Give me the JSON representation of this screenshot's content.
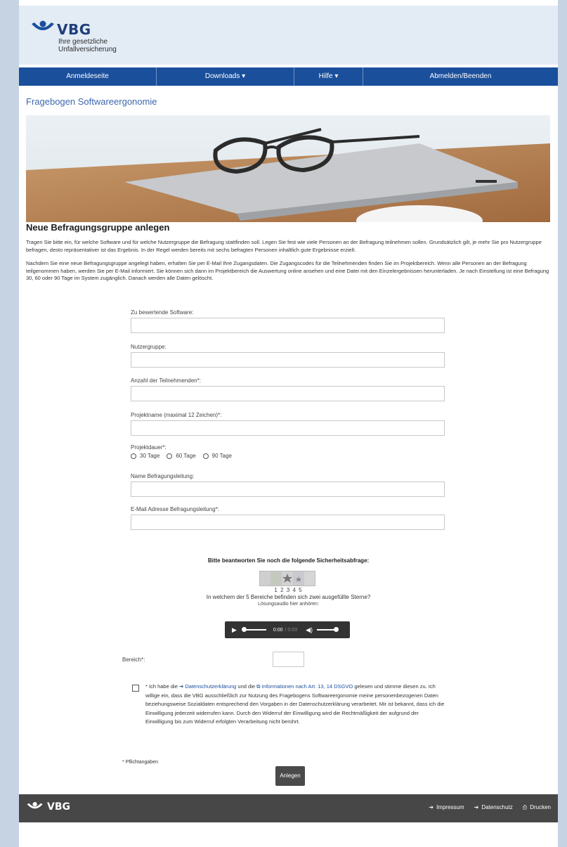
{
  "brand": {
    "name": "VBG",
    "subtitle": "Ihre gesetzliche Unfallversicherung",
    "color": "#1a4f9c"
  },
  "nav": {
    "items": [
      {
        "label": "Anmeldeseite"
      },
      {
        "label": "Downloads ▾"
      },
      {
        "label": "Hilfe ▾"
      },
      {
        "label": "Abmelden/Beenden"
      }
    ]
  },
  "page": {
    "title": "Fragebogen Softwareergonomie",
    "heading": "Neue Befragungsgruppe anlegen",
    "intro_1": "Tragen Sie bitte ein, für welche Software und für welche Nutzergruppe die Befragung stattfinden soll. Legen Sie fest wie viele Personen an der Befragung teilnehmen sollen. Grundsätzlich gilt, je mehr Sie pro Nutzergruppe befragen, desto repräsentativer ist das Ergebnis. In der Regel werden bereits mit sechs befragten Personen inhaltlich gute Ergebnisse erzielt.",
    "intro_2": "Nachdem Sie eine neue Befragungsgruppe angelegt haben, erhalten Sie per E-Mail Ihre Zugangsdaten. Die Zugangscodes für die Teilnehmenden finden Sie im Projektbereich. Wenn alle Personen an der Befragung teilgenommen haben, werden Sie per E-Mail informiert. Sie können sich dann im Projektbereich die Auswertung online ansehen und eine Datei mit den Einzelergebnissen herunterladen. Je nach Einstellung ist eine Befragung 30, 60 oder 90 Tage im System zugänglich. Danach werden alle Daten gelöscht."
  },
  "form": {
    "software_label": "Zu bewertende Software:",
    "software_value": "",
    "nutzergruppe_label": "Nutzergruppe:",
    "nutzergruppe_value": "",
    "anzahl_label": "Anzahl der Teilnehmenden*:",
    "anzahl_value": "",
    "projektname_label": "Projektname (maximal 12 Zeichen)*:",
    "projektname_value": "",
    "projektdauer_label": "Projektdauer*:",
    "projektdauer_options": [
      "30 Tage",
      "60 Tage",
      "90 Tage"
    ],
    "leitung_label": "Name Befragungsleitung:",
    "leitung_value": "",
    "email_label": "E-Mail Adresse Befragungsleitung*:",
    "email_value": ""
  },
  "captcha": {
    "title": "Bitte beantworten Sie noch die folgende Sicherheitsabfrage:",
    "numbers": "1 2 3 4 5",
    "question": "In welchem der 5 Bereiche befinden sich zwei ausgefüllte Sterne?",
    "audio_label": "Lösungsaudio hier anhören:",
    "audio_time": "0:00",
    "audio_duration": "/ 0:03",
    "bereich_label": "Bereich*:",
    "bereich_value": ""
  },
  "consent": {
    "prefix": "* Ich habe die",
    "link1": "Datenschutzerklärung",
    "middle": "und die",
    "link2": "Informationen nach Art. 13, 14 DSGVO",
    "rest": "gelesen und stimme diesen zu. Ich willige ein, dass die VBG ausschließlich zur Nutzung des Fragebogens Softwareergonomie meine personenbezogenen Daten beziehungsweise Sozialdaten entsprechend den Vorgaben in der Datenschutzerklärung verarbeitet. Mir ist bekannt, dass ich die Einwilligung jederzeit widerrufen kann. Durch den Widerruf der Einwilligung wird die Rechtmäßigkeit der aufgrund der Einwilligung bis zum Widerruf erfolgten Verarbeitung nicht berührt."
  },
  "footnote": "* Pflichtangaben",
  "submit_label": "Anlegen",
  "footer": {
    "brand": "VBG",
    "links": [
      "Impressum",
      "Datenschutz",
      "Drucken"
    ]
  }
}
